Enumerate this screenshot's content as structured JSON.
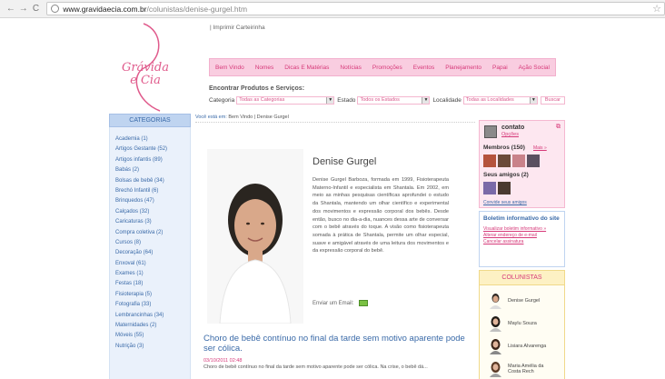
{
  "browser": {
    "url_host": "www.gravidaecia.com.br",
    "url_path": "/colunistas/denise-gurgel.htm"
  },
  "header": {
    "logo_line1": "Grávida",
    "logo_line2": "e Cia",
    "top_link": "|  Imprimir Carteirinha",
    "nav": [
      "Bem Vindo",
      "Nomes",
      "Dicas E Matérias",
      "Notícias",
      "Promoções",
      "Eventos",
      "Planejamento",
      "Papai",
      "Ação Social"
    ]
  },
  "search": {
    "title": "Encontrar Produtos e Serviços:",
    "categoria_label": "Categoria",
    "categoria_value": "Todas as Categorias",
    "estado_label": "Estado",
    "estado_value": "Todos os Estados",
    "localidade_label": "Localidade",
    "localidade_value": "Todas as Localidades",
    "button": "Buscar"
  },
  "sidebar": {
    "header": "CATEGORIAS",
    "items": [
      "Academia (1)",
      "Artigos Gestante (52)",
      "Artigos infantis (89)",
      "Babás (2)",
      "Bolsas de bebê (34)",
      "Brechó Infantil (6)",
      "Brinquedos (47)",
      "Calçados (32)",
      "Caricaturas (3)",
      "Compra coletiva (2)",
      "Cursos (8)",
      "Decoração (64)",
      "Enxoval (61)",
      "Exames (1)",
      "Festas (18)",
      "Fisioterapia (5)",
      "Fotografia (33)",
      "Lembrancinhas (34)",
      "Maternidades (2)",
      "Móveis (55)",
      "Nutrição (3)"
    ]
  },
  "breadcrumb": {
    "label": "Você está em:",
    "trail": "Bem Vindo  |  Denise Gurgel"
  },
  "profile": {
    "name": "Denise Gurgel",
    "bio": "Denise Gurgel Barboza, formada em 1999, Fisioterapeuta Materno-Infantil e especialista em Shantala. Em 2002, em meio as minhas pesquisas científicas aprofundei o estudo da Shantala, mantendo um olhar científico e experimental dos movimentos e expressão corporal dos bebês. Desde então, busco no dia-a-dia, nuances dessa arte de conversar com o bebê através do toque. A visão como fisioterapeuta somada à prática de Shantala, permite um olhar especial, suave e amigável através de uma leitura dos movimentos e da expressão corporal do bebê.",
    "email_label": "Enviar um Email:"
  },
  "post": {
    "title": "Choro de bebê contínuo no final da tarde sem motivo aparente pode ser cólica.",
    "date": "03/10/2011 02:48",
    "excerpt": "Choro de bebê contínuo no final da tarde sem motivo aparente pode ser cólica. Na crise, o bebê dá..."
  },
  "contact": {
    "name": "contato",
    "options": "Opções",
    "members": "Membros (150)",
    "members_more": "Mais »",
    "friends": "Seus amigos (2)",
    "invite": "Convide seus amigos"
  },
  "newsletter": {
    "title": "Boletim informativo do site",
    "links": [
      "Visualizar boletim informativo »",
      "Alterar endereço de e-mail",
      "Cancelar assinatura"
    ]
  },
  "colunistas": {
    "header": "COLUNISTAS",
    "items": [
      "Denise Gurgel",
      "Maylu Souza",
      "Lisiara Alvarenga",
      "Maria Amélia da Costa Rech"
    ]
  },
  "colors": {
    "brand_pink": "#d63979",
    "nav_bg": "#f9cde0",
    "link_blue": "#3a6aa8",
    "sidebar_bg": "#eaf1fb"
  }
}
